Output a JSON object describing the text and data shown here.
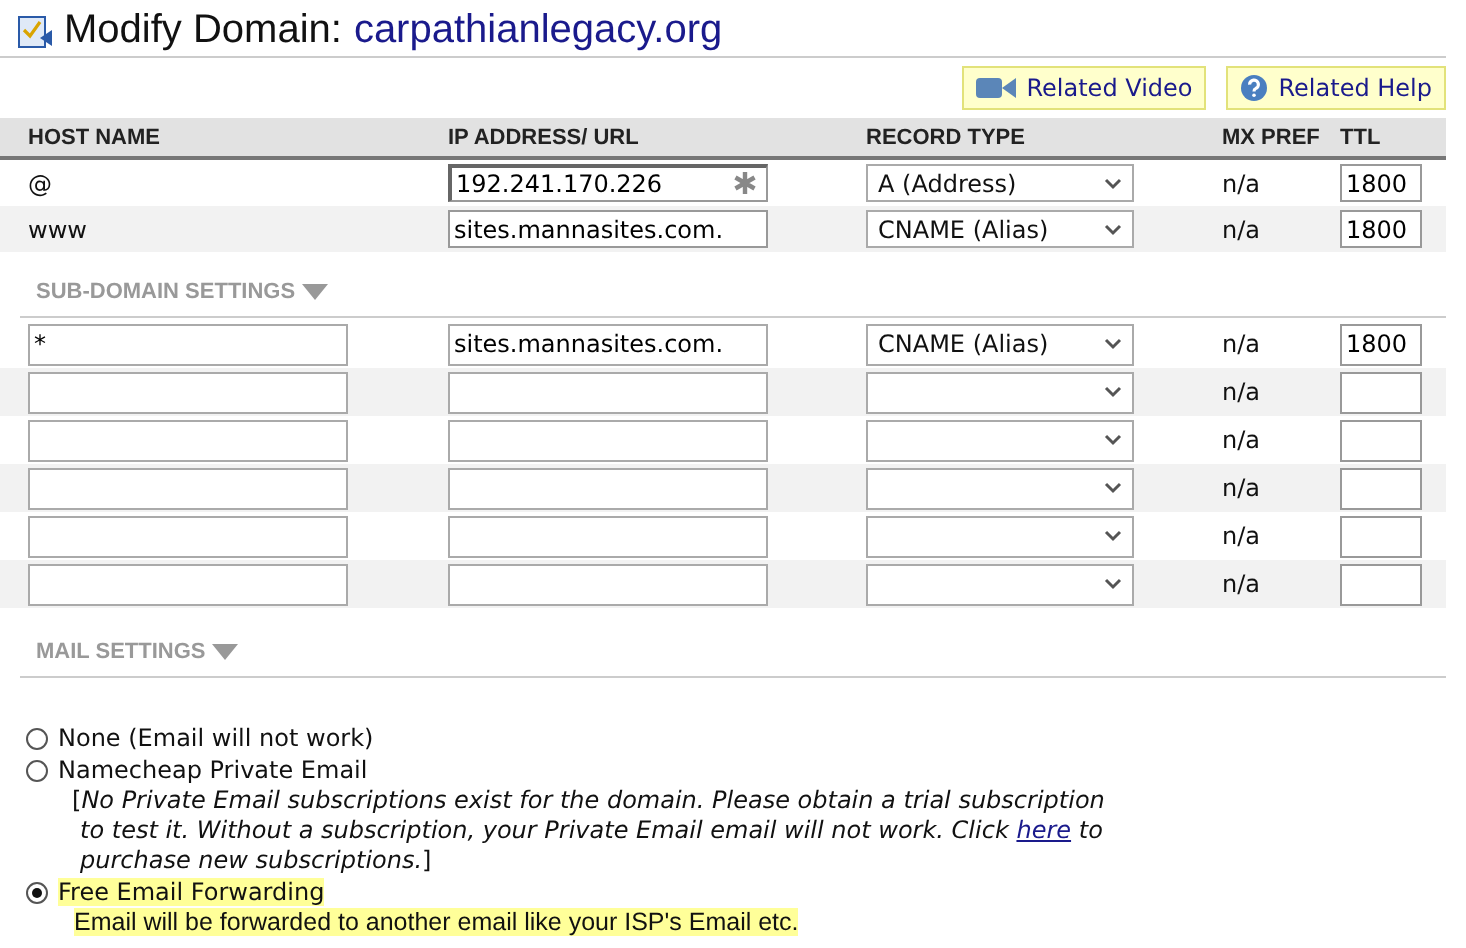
{
  "title": {
    "label": "Modify Domain:",
    "domain": "carpathianlegacy.org"
  },
  "related": [
    {
      "kind": "video",
      "label": "Related Video"
    },
    {
      "kind": "help",
      "label": "Related Help"
    }
  ],
  "table": {
    "columns": [
      "HOST NAME",
      "IP ADDRESS/ URL",
      "RECORD TYPE",
      "MX PREF",
      "TTL"
    ],
    "rows": [
      {
        "host": "@",
        "address": "192.241.170.226",
        "required": true,
        "record_type": "A (Address)",
        "mx_pref": "n/a",
        "ttl": "1800"
      },
      {
        "host": "www",
        "address": "sites.mannasites.com.",
        "required": false,
        "record_type": "CNAME (Alias)",
        "mx_pref": "n/a",
        "ttl": "1800"
      }
    ]
  },
  "subdomain": {
    "heading": "SUB-DOMAIN SETTINGS",
    "rows": [
      {
        "host": "*",
        "address": "sites.mannasites.com.",
        "record_type": "CNAME (Alias)",
        "mx_pref": "n/a",
        "ttl": "1800"
      },
      {
        "mx_pref": "n/a"
      },
      {
        "mx_pref": "n/a"
      },
      {
        "mx_pref": "n/a"
      },
      {
        "mx_pref": "n/a"
      },
      {
        "mx_pref": "n/a"
      }
    ]
  },
  "mail": {
    "heading": "MAIL SETTINGS",
    "options": [
      {
        "label": "None (Email will not work)",
        "selected": false
      },
      {
        "label": "Namecheap Private Email",
        "selected": false,
        "note_before": "[*No Private Email subscriptions exist for the domain. Please obtain a trial subscription to test it. Without a subscription, your Private Email email will not work. Click*",
        "note_link": "here",
        "note_after": "*to purchase new subscriptions.*]"
      },
      {
        "label": "Free Email Forwarding",
        "selected": true,
        "highlight": true,
        "description": "Email will be forwarded to another email like your ISP's Email etc."
      }
    ]
  }
}
